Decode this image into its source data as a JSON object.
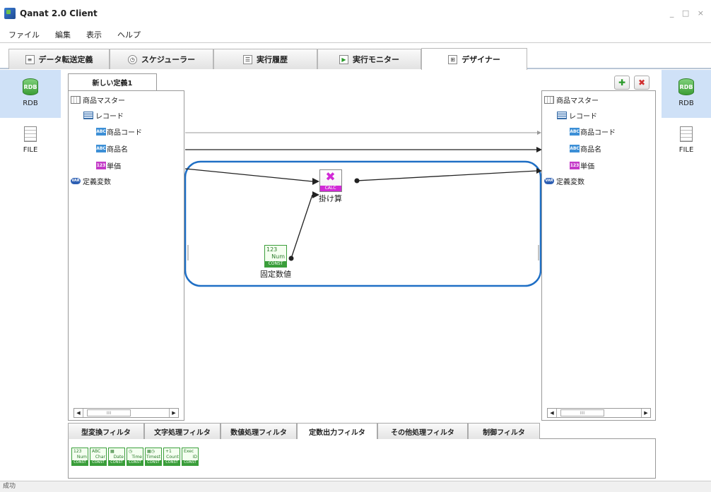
{
  "app": {
    "title": "Qanat 2.0 Client",
    "window_controls": "_ □ ×"
  },
  "menu": [
    "ファイル",
    "編集",
    "表示",
    "ヘルプ"
  ],
  "tabs": [
    {
      "label": "データ転送定義",
      "icon": "document-icon"
    },
    {
      "label": "スケジューラー",
      "icon": "clock-icon"
    },
    {
      "label": "実行履歴",
      "icon": "history-icon"
    },
    {
      "label": "実行モニター",
      "icon": "play-icon"
    },
    {
      "label": "デザイナー",
      "icon": "designer-icon",
      "active": true
    }
  ],
  "left_pane": {
    "items": [
      {
        "label": "RDB",
        "icon_text": "RDB",
        "selected": true
      },
      {
        "label": "FILE"
      }
    ]
  },
  "right_pane": {
    "items": [
      {
        "label": "RDB",
        "icon_text": "RDB",
        "selected": true
      },
      {
        "label": "FILE"
      }
    ]
  },
  "definition_tab": "新しい定義1",
  "source_tree": {
    "table": "商品マスター",
    "record": "レコード",
    "fields": [
      {
        "type": "ABC",
        "name": "商品コード"
      },
      {
        "type": "ABC",
        "name": "商品名"
      },
      {
        "type": "123",
        "name": "単価"
      }
    ],
    "variables": "定義変数",
    "var_badge": "VAR"
  },
  "target_tree": {
    "table": "商品マスター",
    "record": "レコード",
    "fields": [
      {
        "type": "ABC",
        "name": "商品コード"
      },
      {
        "type": "ABC",
        "name": "商品名"
      },
      {
        "type": "123",
        "name": "単価"
      }
    ],
    "variables": "定義変数",
    "var_badge": "VAR"
  },
  "canvas": {
    "calc_node": {
      "label": "掛け算",
      "tag": "CALC"
    },
    "const_node": {
      "label": "固定数値",
      "top": "123",
      "mid": "Num",
      "tag": "CONST"
    }
  },
  "filter_tabs": [
    {
      "label": "型変換フィルタ"
    },
    {
      "label": "文字処理フィルタ"
    },
    {
      "label": "数値処理フィルタ"
    },
    {
      "label": "定数出力フィルタ",
      "active": true
    },
    {
      "label": "その他処理フィルタ"
    },
    {
      "label": "制御フィルタ"
    }
  ],
  "palette": [
    {
      "top": "123",
      "mid": "Num",
      "tag": "CONST"
    },
    {
      "top": "ABC",
      "mid": "Char",
      "tag": "CONST"
    },
    {
      "top": "▦",
      "mid": "Date",
      "tag": "CONST"
    },
    {
      "top": "◷",
      "mid": "Time",
      "tag": "CONST"
    },
    {
      "top": "▦◷",
      "mid": "Timest",
      "tag": "CONST"
    },
    {
      "top": "+1",
      "mid": "Count",
      "tag": "CONST"
    },
    {
      "top": "Exec",
      "mid": "ID",
      "tag": "CONST"
    }
  ],
  "scroll_thumb": "IIII",
  "status": "成功",
  "colors": {
    "accent_blue": "#1f6fc5",
    "calc_magenta": "#d12ad6",
    "const_green": "#3a9e3a",
    "selected_bg": "#cfe1f7"
  }
}
